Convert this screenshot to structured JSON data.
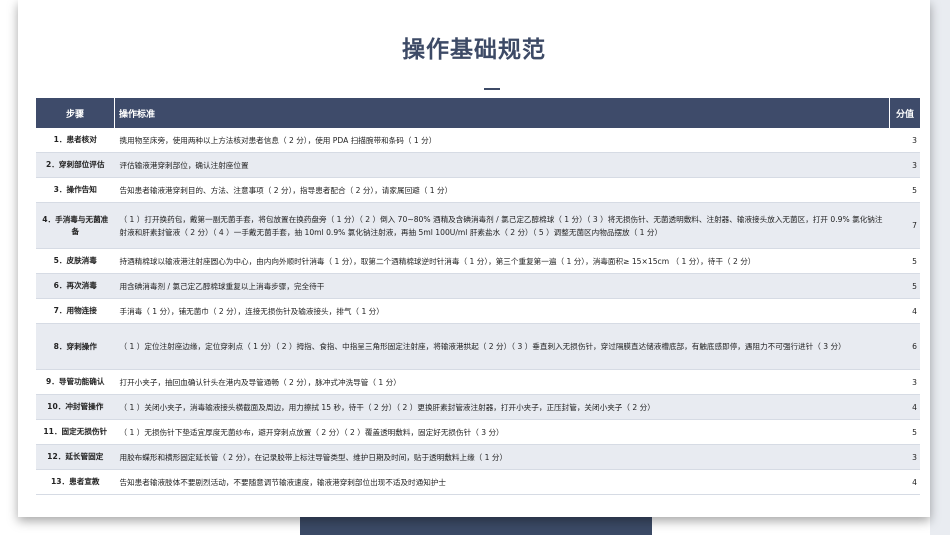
{
  "title": "操作基础规范",
  "headers": {
    "step": "步骤",
    "standard": "操作标准",
    "score": "分值"
  },
  "rows": [
    {
      "step": "1．患者核对",
      "standard": "携用物至床旁，使用两种以上方法核对患者信息（ 2 分），使用 PDA 扫描腕带和条码（ 1 分）",
      "score": "3"
    },
    {
      "step": "2．穿刺部位评估",
      "standard": "评估输液港穿刺部位，确认注射座位置",
      "score": "3"
    },
    {
      "step": "3．操作告知",
      "standard": "告知患者输液港穿刺目的、方法、注意事项（ 2 分），指导患者配合（ 2 分），请家属回避（ 1 分）",
      "score": "5"
    },
    {
      "step": "4．手消毒与无菌准备",
      "standard": "（ 1 ）打开换药包，戴第一副无菌手套，将包放置在换药盘旁（ 1 分）（ 2 ）倒入 70~80% 酒精及含碘消毒剂 / 氯己定乙醇棉球（ 1 分）（ 3 ）将无损伤针、无菌透明敷料、注射器、输液接头放入无菌区，打开 0.9% 氯化钠注射液和肝素封管液（ 2 分）（ 4 ）一手戴无菌手套，抽 10ml 0.9% 氯化钠注射液，再抽 5ml 100U/ml 肝素盐水（ 2 分）（ 5 ）调整无菌区内物品摆放（ 1 分）",
      "score": "7"
    },
    {
      "step": "5．皮肤消毒",
      "standard": "持酒精棉球以输液港注射座圆心为中心，由内向外顺时针消毒（ 1 分），取第二个酒精棉球逆时针消毒（ 1 分），第三个重复第一遍（ 1 分），消毒面积≥ 15×15cm （ 1 分），待干（ 2 分）",
      "score": "5"
    },
    {
      "step": "6．再次消毒",
      "standard": "用含碘消毒剂 / 氯己定乙醇棉球重复以上消毒步骤，完全待干",
      "score": "5"
    },
    {
      "step": "7．用物连接",
      "standard": "手消毒（ 1 分），铺无菌巾（ 2 分），连接无损伤针及输液接头，排气（ 1 分）",
      "score": "4"
    },
    {
      "step": "8．穿刺操作",
      "standard": "（ 1 ）定位注射座边缘，定位穿刺点（ 1 分）（ 2 ）拇指、食指、中指呈三角形固定注射座，将输液港拱起（ 2 分）（ 3 ）垂直刺入无损伤针，穿过隔膜直达储液槽底部，有触底感即停，遇阻力不可强行进针（ 3 分）",
      "score": "6"
    },
    {
      "step": "9．导管功能确认",
      "standard": "打开小夹子，抽回血确认针头在港内及导管通畅（ 2 分），脉冲式冲洗导管（ 1 分）",
      "score": "3"
    },
    {
      "step": "10．冲封管操作",
      "standard": "（ 1 ）关闭小夹子，消毒输液接头横截面及周边，用力擦拭 15 秒，待干（ 2 分）（ 2 ）更换肝素封管液注射器，打开小夹子，正压封管，关闭小夹子（ 2 分）",
      "score": "4"
    },
    {
      "step": "11．固定无损伤针",
      "standard": "（ 1 ）无损伤针下垫适宜厚度无菌纱布，避开穿刺点放置（ 2 分）（ 2 ）覆盖透明敷料，固定好无损伤针（ 3 分）",
      "score": "5"
    },
    {
      "step": "12．延长管固定",
      "standard": "用胶布蝶形和横形固定延长管（ 2 分），在记录胶带上标注导管类型、维护日期及时间，贴于透明敷料上缘（ 1 分）",
      "score": "3"
    },
    {
      "step": "13．患者宣教",
      "standard": "告知患者输液肢体不要剧烈活动，不要随意调节输液速度，输液港穿刺部位出现不适及时通知护士",
      "score": "4"
    }
  ],
  "colors": {
    "header_bg": "#3e4b6a",
    "title": "#3d4a66",
    "band": "#3b4a66",
    "alt_row": "#e8ebf1"
  }
}
